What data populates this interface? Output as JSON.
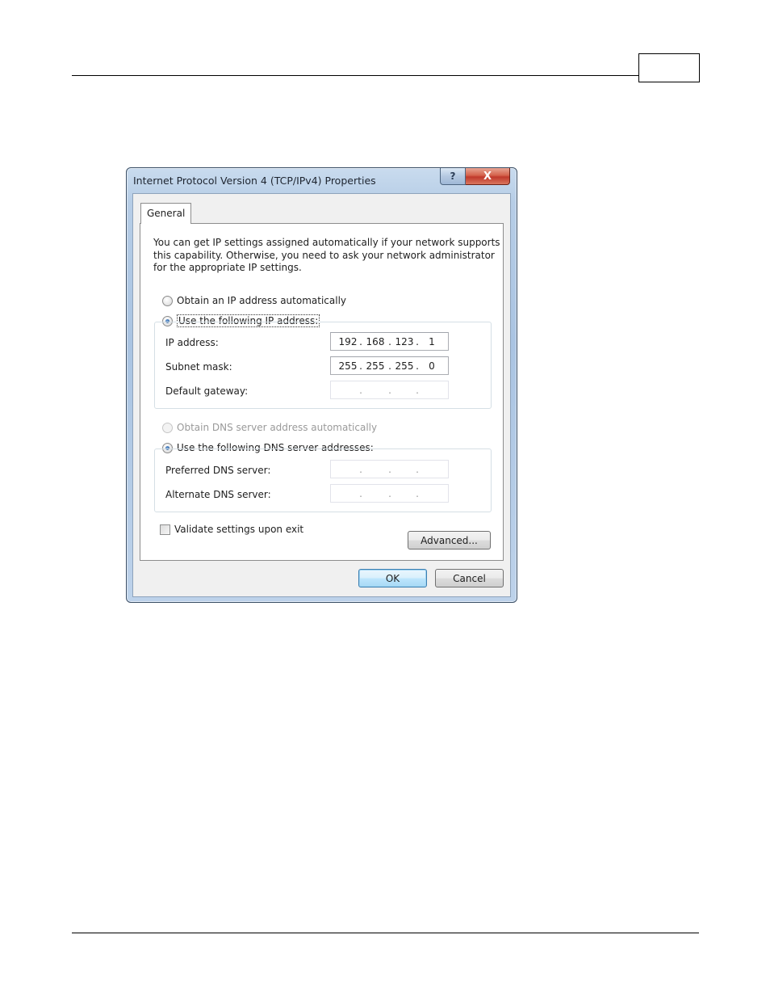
{
  "dialog": {
    "title": "Internet Protocol Version 4 (TCP/IPv4) Properties",
    "help_glyph": "?",
    "close_glyph": "X"
  },
  "tabs": [
    {
      "label": "General",
      "selected": true
    }
  ],
  "general": {
    "intro_lines": [
      "You can get IP settings assigned automatically if your network supports",
      "this capability. Otherwise, you need to ask your network administrator",
      "for the appropriate IP settings."
    ],
    "ip_auto_label": "Obtain an IP address automatically",
    "ip_manual_label": "Use the following IP address:",
    "ip_mode_selected": "manual",
    "ip_address": {
      "label": "IP address:",
      "octets": [
        "192",
        "168",
        "123",
        "1"
      ]
    },
    "subnet_mask": {
      "label": "Subnet mask:",
      "octets": [
        "255",
        "255",
        "255",
        "0"
      ]
    },
    "default_gateway": {
      "label": "Default gateway:",
      "octets": [
        "",
        "",
        "",
        ""
      ]
    },
    "dns_auto_label": "Obtain DNS server address automatically",
    "dns_manual_label": "Use the following DNS server addresses:",
    "dns_mode_selected": "manual",
    "preferred_dns": {
      "label": "Preferred DNS server:",
      "octets": [
        "",
        "",
        "",
        ""
      ]
    },
    "alternate_dns": {
      "label": "Alternate DNS server:",
      "octets": [
        "",
        "",
        "",
        ""
      ]
    },
    "validate_label": "Validate settings upon exit",
    "validate_checked": false,
    "advanced_label": "Advanced..."
  },
  "buttons": {
    "ok_label": "OK",
    "cancel_label": "Cancel"
  },
  "colors": {
    "frame": "#b6cde6",
    "close_button": "#c0392b",
    "default_button_border": "#3c7fb1"
  }
}
